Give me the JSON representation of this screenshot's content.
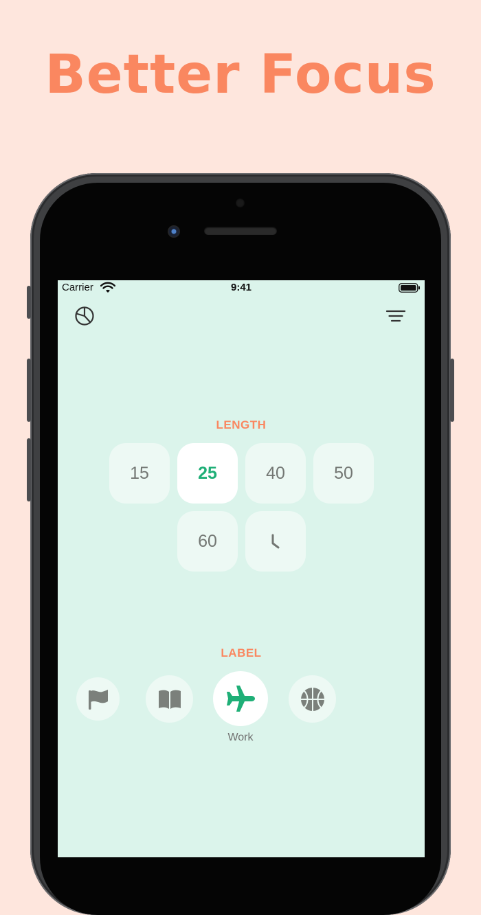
{
  "headline": "Better Focus",
  "status_bar": {
    "carrier": "Carrier",
    "time": "9:41"
  },
  "toolbar": {
    "stats_icon": "pie-chart-icon",
    "menu_icon": "filter-lines-icon"
  },
  "length": {
    "title": "LENGTH",
    "options": [
      "15",
      "25",
      "40",
      "50",
      "60"
    ],
    "selected": "25",
    "custom_icon": "clock-icon"
  },
  "label": {
    "title": "LABEL",
    "options": [
      {
        "icon": "flag-icon"
      },
      {
        "icon": "book-icon"
      },
      {
        "icon": "airplane-icon",
        "name": "Work"
      },
      {
        "icon": "basketball-icon"
      }
    ],
    "selected_name": "Work"
  },
  "colors": {
    "background": "#FEE6DD",
    "accent": "#FA8760",
    "screen": "#DBF4EB",
    "selected_green": "#1FAF77",
    "icon_gray": "#737773"
  }
}
